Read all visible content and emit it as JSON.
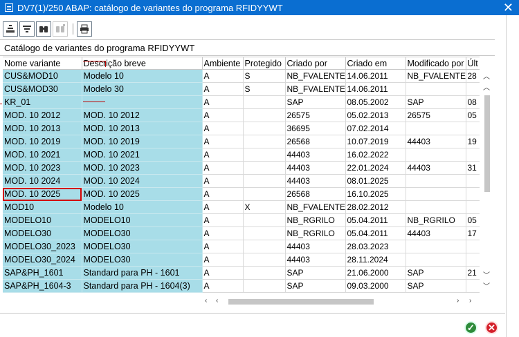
{
  "window": {
    "title": "DV7(1)/250 ABAP: catálogo de variantes do programa RFIDYYWT"
  },
  "toolbar": {
    "buttons": [
      {
        "name": "sort-ascending-icon",
        "glyph": "≡",
        "enabled": true
      },
      {
        "name": "filter-icon",
        "glyph": "▽",
        "enabled": true
      },
      {
        "name": "find-binoculars-icon",
        "glyph": "⌕",
        "enabled": true
      },
      {
        "name": "find-next-icon",
        "glyph": "⌕",
        "enabled": false
      },
      {
        "name": "print-icon",
        "glyph": "⎙",
        "enabled": true
      }
    ]
  },
  "catalog": {
    "label": "Catálogo de variantes do programa RFIDYYWT"
  },
  "table": {
    "columns": [
      "Nome variante",
      "Descrição breve",
      "Ambiente",
      "Protegido",
      "Criado por",
      "Criado em",
      "Modificado por",
      "Últ"
    ],
    "rows": [
      [
        "CUS&MOD10",
        "Modelo 10",
        "A",
        "S",
        "NB_FVALENTE",
        "14.06.2011",
        "NB_FVALENTE",
        "28"
      ],
      [
        "CUS&MOD30",
        "Modelo 30",
        "A",
        "S",
        "NB_FVALENTE",
        "14.06.2011",
        "",
        ""
      ],
      [
        "KR_01",
        "",
        "A",
        "",
        "SAP",
        "08.05.2002",
        "SAP",
        "08"
      ],
      [
        "MOD. 10 2012",
        "MOD. 10 2012",
        "A",
        "",
        "26575",
        "05.02.2013",
        "26575",
        "05"
      ],
      [
        "MOD. 10 2013",
        "MOD. 10 2013",
        "A",
        "",
        "36695",
        "07.02.2014",
        "",
        ""
      ],
      [
        "MOD. 10 2019",
        "MOD. 10 2019",
        "A",
        "",
        "26568",
        "10.07.2019",
        "44403",
        "19"
      ],
      [
        "MOD. 10 2021",
        "MOD. 10 2021",
        "A",
        "",
        "44403",
        "16.02.2022",
        "",
        ""
      ],
      [
        "MOD. 10 2023",
        "MOD. 10 2023",
        "A",
        "",
        "44403",
        "22.01.2024",
        "44403",
        "31"
      ],
      [
        "MOD. 10 2024",
        "MOD. 10 2024",
        "A",
        "",
        "44403",
        "08.01.2025",
        "",
        ""
      ],
      [
        "MOD. 10 2025",
        "MOD. 10 2025",
        "A",
        "",
        "26568",
        "16.10.2025",
        "",
        ""
      ],
      [
        "MOD10",
        "Modelo 10",
        "A",
        "X",
        "NB_FVALENTE",
        "28.02.2012",
        "",
        ""
      ],
      [
        "MODELO10",
        "MODELO10",
        "A",
        "",
        "NB_RGRILO",
        "05.04.2011",
        "NB_RGRILO",
        "05"
      ],
      [
        "MODELO30",
        "MODELO30",
        "A",
        "",
        "NB_RGRILO",
        "05.04.2011",
        "44403",
        "17"
      ],
      [
        "MODELO30_2023",
        "MODELO30",
        "A",
        "",
        "44403",
        "28.03.2023",
        "",
        ""
      ],
      [
        "MODELO30_2024",
        "MODELO30",
        "A",
        "",
        "44403",
        "28.11.2024",
        "",
        ""
      ],
      [
        "SAP&PH_1601",
        "Standard para PH - 1601",
        "A",
        "",
        "SAP",
        "21.06.2000",
        "SAP",
        "21"
      ],
      [
        "SAP&PH_1604-3",
        "Standard para PH - 1604(3)",
        "A",
        "",
        "SAP",
        "09.03.2000",
        "SAP",
        ""
      ]
    ],
    "selected_row": "MOD. 10 2025"
  },
  "footer": {
    "ok_glyph": "✓",
    "cancel_glyph": "✕"
  }
}
